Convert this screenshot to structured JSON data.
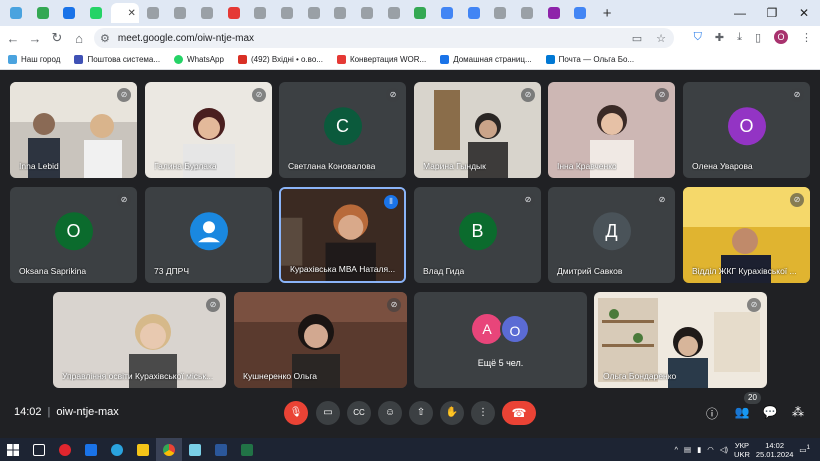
{
  "browser": {
    "tab_colors": [
      "#4aa3df",
      "#34a853",
      "#1a73e8",
      "#25d366",
      "#ffffff",
      "#9aa0a6",
      "#9aa0a6",
      "#9aa0a6",
      "#e53935",
      "#9aa0a6",
      "#9aa0a6",
      "#9aa0a6",
      "#9aa0a6",
      "#9aa0a6",
      "#9aa0a6",
      "#34a853",
      "#4285f4",
      "#4285f4",
      "#9aa0a6",
      "#9aa0a6",
      "#8e24aa",
      "#4285f4"
    ],
    "url": "meet.google.com/oiw-ntje-max",
    "profile_initial": "O"
  },
  "bookmarks": [
    {
      "label": "Наш город",
      "color": "#4aa3df"
    },
    {
      "label": "Поштова система...",
      "color": "#3f51b5"
    },
    {
      "label": "WhatsApp",
      "color": "#25d366"
    },
    {
      "label": "(492) Вхідні • о.во...",
      "color": "#d93025"
    },
    {
      "label": "Конвертация WOR...",
      "color": "#e53935"
    },
    {
      "label": "Домашная страниц...",
      "color": "#1a73e8"
    },
    {
      "label": "Почта — Ольга Бо...",
      "color": "#0078d4"
    }
  ],
  "participants": {
    "p1": "Inna Lebid",
    "p2": "Галина Бурлака",
    "p3": {
      "name": "Светлана Коновалова",
      "initial": "С",
      "color": "#0b5a3c"
    },
    "p4": "Марина Гындык",
    "p5": "Інна Кравченко",
    "p6": {
      "name": "Олена Уварова",
      "initial": "О",
      "color": "#9334c4"
    },
    "p7": {
      "name": "Oksana Saprikina",
      "initial": "О",
      "color": "#0b6b2d"
    },
    "p8": {
      "name": "73 ДПРЧ"
    },
    "p9": "Курахівська МВА Наталя...",
    "p10": {
      "name": "Влад Гида",
      "initial": "В",
      "color": "#0b6b2d"
    },
    "p11": {
      "name": "Дмитрий Савков",
      "initial": "Д",
      "color": "#4a5359"
    },
    "p12": "Відділ ЖКГ Курахівської ...",
    "p13": "Управління освіти Курахівської міськ...",
    "p14": "Кушнеренко Ольга",
    "p15": {
      "label": "Ещё 5 чел.",
      "a1": "А",
      "a1color": "#e8457a",
      "a2": "О",
      "a2color": "#5b6bd4"
    },
    "p16": "Ольга Бондаренко"
  },
  "meeting": {
    "time": "14:02",
    "code": "oiw-ntje-max",
    "people_count": "20"
  },
  "taskbar": {
    "lang": "УКР",
    "lang2": "UKR",
    "time": "14:02",
    "date": "25.01.2024",
    "notif": "1"
  }
}
